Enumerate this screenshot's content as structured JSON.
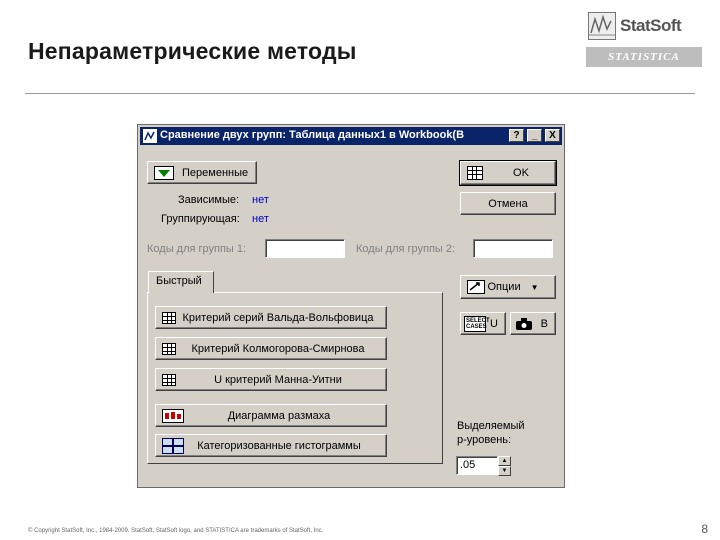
{
  "slide": {
    "title": "Непараметрические методы",
    "logo_name": "StatSoft",
    "logo_sub": "STATISTICA",
    "footer": "© Copyright StatSoft, Inc., 1984-2009. StatSoft, StatSoft logo, and  STATISTICA are trademarks of StatSoft, Inc.",
    "page_number": "8"
  },
  "dialog": {
    "title": "Сравнение двух групп: Таблица данных1 в Workbook(B",
    "help_btn": "?",
    "minimize_btn": "_",
    "close_btn": "X",
    "variables_btn": "Переменные",
    "dependent_label": "Зависимые:",
    "dependent_value": "нет",
    "grouping_label": "Группирующая:",
    "grouping_value": "нет",
    "group1_codes_label": "Коды для группы 1:",
    "group1_codes_value": "",
    "group2_codes_label": "Коды для группы 2:",
    "group2_codes_value": "",
    "ok_btn": "OK",
    "cancel_btn": "Отмена",
    "options_btn": "Опции",
    "select_cases_icon_text": "SELECT CASES",
    "select_u": "U",
    "weight_b": "B",
    "tab_quick": "Быстрый",
    "tests": [
      "Критерий серий Вальда-Вольфовица",
      "Критерий Колмогорова-Смирнова",
      "U критерий Манна-Уитни",
      "Диаграмма размаха",
      "Категоризованные гистограммы"
    ],
    "p_level_label_1": "Выделяемый",
    "p_level_label_2": "р-уровень:",
    "p_level_value": ".05"
  }
}
